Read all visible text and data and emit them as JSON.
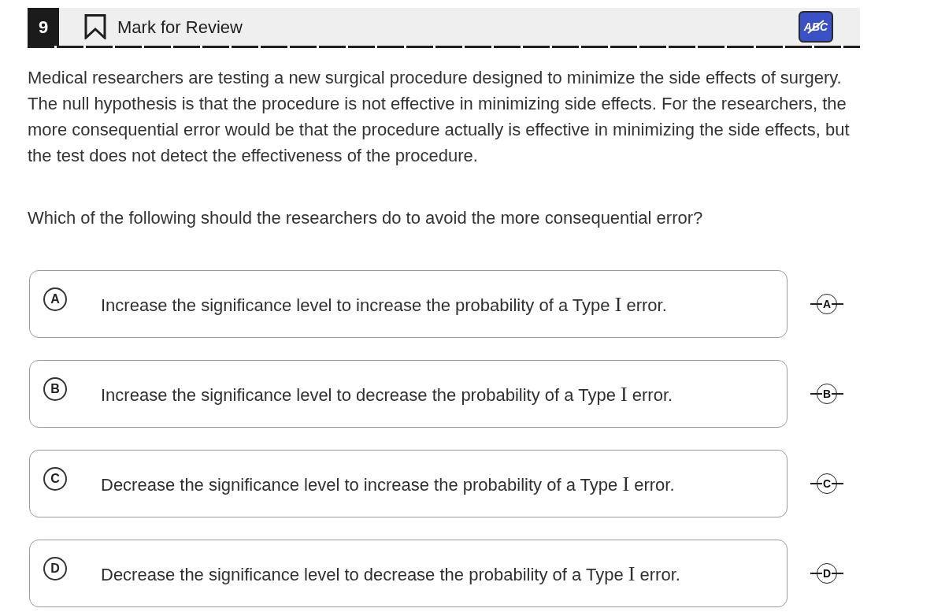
{
  "header": {
    "question_number": "9",
    "mark_for_review": {
      "label": "Mark for Review",
      "marked": false
    },
    "cross_out_tool": {
      "label": "ABC",
      "active": true
    }
  },
  "passage": "Medical researchers are testing a new surgical procedure designed to minimize the side effects of surgery. The null hypothesis is that the procedure is not effective in minimizing side effects. For the researchers, the more consequential error would be that the procedure actually is effective in minimizing the side effects, but the test does not detect the effectiveness of the procedure.",
  "prompt": "Which of the following should the researchers do to avoid the more consequential error?",
  "choices": [
    {
      "letter": "A",
      "selected": false,
      "crossed_out": false,
      "cross_out_label": "A",
      "segments": [
        {
          "kind": "text",
          "text": "Increase the significance level to increase the probability of a Type "
        },
        {
          "kind": "math",
          "text": "I"
        },
        {
          "kind": "text",
          "text": " error."
        }
      ]
    },
    {
      "letter": "B",
      "selected": false,
      "crossed_out": false,
      "cross_out_label": "B",
      "segments": [
        {
          "kind": "text",
          "text": "Increase the significance level to decrease the probability of a Type "
        },
        {
          "kind": "math",
          "text": "I"
        },
        {
          "kind": "text",
          "text": " error."
        }
      ]
    },
    {
      "letter": "C",
      "selected": false,
      "crossed_out": false,
      "cross_out_label": "C",
      "segments": [
        {
          "kind": "text",
          "text": "Decrease the significance level to increase the probability of a Type "
        },
        {
          "kind": "math",
          "text": "I"
        },
        {
          "kind": "text",
          "text": " error."
        }
      ]
    },
    {
      "letter": "D",
      "selected": false,
      "crossed_out": false,
      "cross_out_label": "D",
      "segments": [
        {
          "kind": "text",
          "text": "Decrease the significance level to decrease the probability of a Type "
        },
        {
          "kind": "math",
          "text": "I"
        },
        {
          "kind": "text",
          "text": " error."
        }
      ]
    }
  ]
}
